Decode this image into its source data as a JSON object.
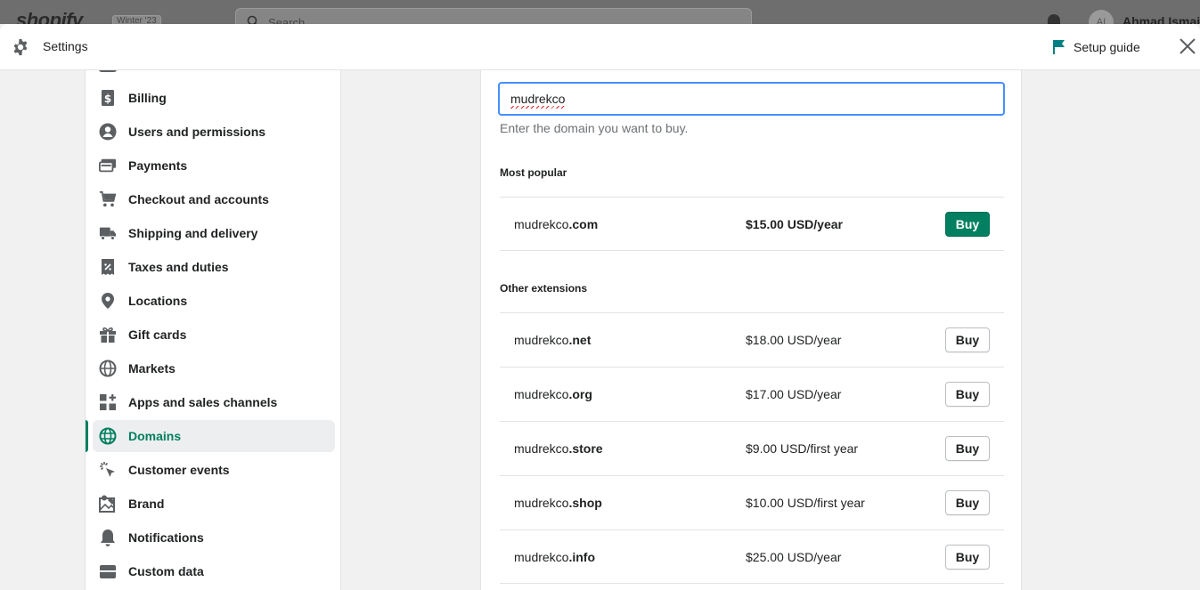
{
  "background": {
    "logo": "shopify",
    "badge": "Winter '23",
    "search_placeholder": "Search",
    "avatar_initials": "AI",
    "user_name": "Ahmad Ismail"
  },
  "header": {
    "title": "Settings",
    "setup_guide": "Setup guide"
  },
  "sidebar": {
    "items": [
      {
        "label": "Billing",
        "icon": "billing-icon"
      },
      {
        "label": "Users and permissions",
        "icon": "user-icon"
      },
      {
        "label": "Payments",
        "icon": "payments-icon"
      },
      {
        "label": "Checkout and accounts",
        "icon": "cart-icon"
      },
      {
        "label": "Shipping and delivery",
        "icon": "truck-icon"
      },
      {
        "label": "Taxes and duties",
        "icon": "tax-icon"
      },
      {
        "label": "Locations",
        "icon": "location-pin-icon"
      },
      {
        "label": "Gift cards",
        "icon": "gift-icon"
      },
      {
        "label": "Markets",
        "icon": "globe-icon"
      },
      {
        "label": "Apps and sales channels",
        "icon": "apps-icon"
      },
      {
        "label": "Domains",
        "icon": "domain-globe-icon",
        "active": true
      },
      {
        "label": "Customer events",
        "icon": "cursor-click-icon"
      },
      {
        "label": "Brand",
        "icon": "brand-icon"
      },
      {
        "label": "Notifications",
        "icon": "bell-icon"
      },
      {
        "label": "Custom data",
        "icon": "custom-data-icon"
      }
    ]
  },
  "domain_search": {
    "value": "mudrekco",
    "help_text": "Enter the domain you want to buy."
  },
  "most_popular": {
    "title": "Most popular",
    "rows": [
      {
        "base": "mudrekco",
        "ext": ".com",
        "price": "$15.00 USD/year",
        "button": "Buy"
      }
    ]
  },
  "other_extensions": {
    "title": "Other extensions",
    "rows": [
      {
        "base": "mudrekco",
        "ext": ".net",
        "price": "$18.00 USD/year",
        "button": "Buy"
      },
      {
        "base": "mudrekco",
        "ext": ".org",
        "price": "$17.00 USD/year",
        "button": "Buy"
      },
      {
        "base": "mudrekco",
        "ext": ".store",
        "price": "$9.00 USD/first year",
        "button": "Buy"
      },
      {
        "base": "mudrekco",
        "ext": ".shop",
        "price": "$10.00 USD/first year",
        "button": "Buy"
      },
      {
        "base": "mudrekco",
        "ext": ".info",
        "price": "$25.00 USD/year",
        "button": "Buy"
      }
    ]
  },
  "colors": {
    "accent": "#008060",
    "focus": "#458fff"
  }
}
